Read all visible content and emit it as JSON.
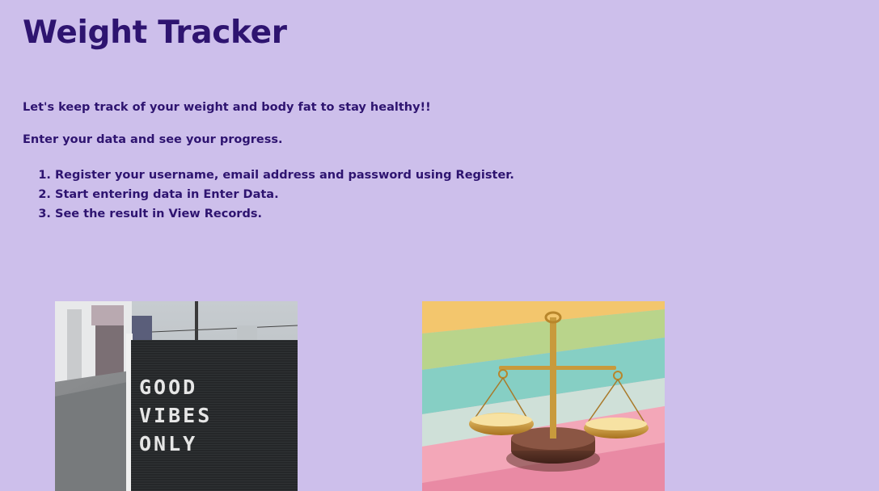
{
  "page": {
    "title": "Weight Tracker",
    "intro_line_1": "Let's keep track of your weight and body fat to stay healthy!!",
    "intro_line_2": "Enter your data and see your progress.",
    "steps": [
      "Register your username, email address and password using Register.",
      "Start entering data in Enter Data.",
      "See the result in View Records."
    ]
  },
  "images": {
    "left": {
      "icon": "letterboard-photo",
      "sign_lines": [
        "GOOD",
        "VIBES",
        "ONLY"
      ]
    },
    "right": {
      "icon": "balance-scale-photo"
    }
  },
  "colors": {
    "background": "#cdbfeb",
    "text": "#2e1470"
  }
}
